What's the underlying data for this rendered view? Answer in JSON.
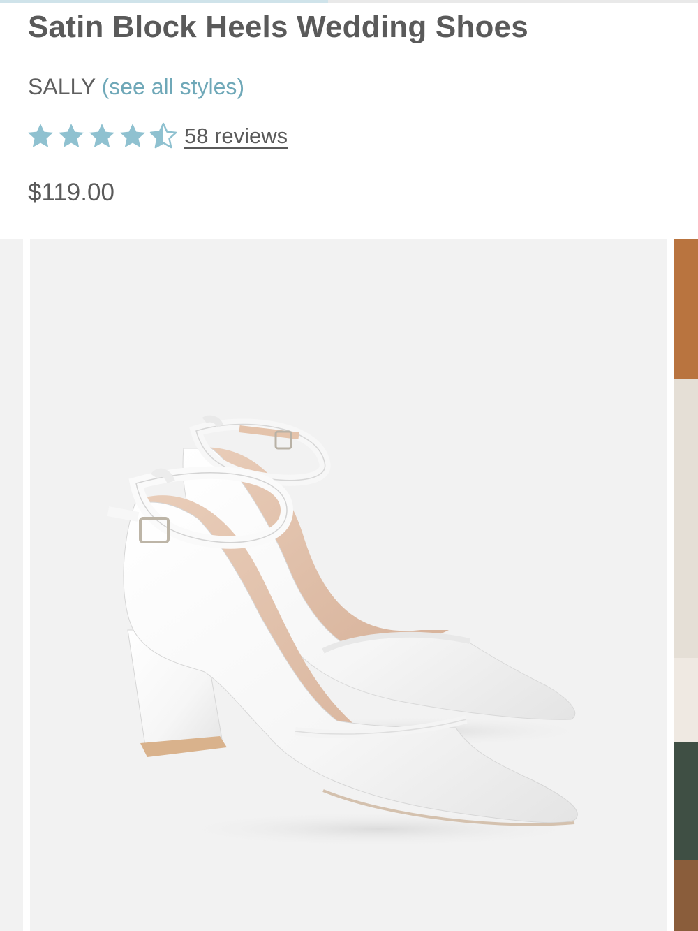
{
  "loading_progress": 0.47,
  "product": {
    "title": "Satin Block Heels Wedding Shoes",
    "brand": "SALLY",
    "see_all_label": "(see all styles)",
    "rating": 4.5,
    "rating_max": 5,
    "reviews_label": "58 reviews",
    "price": "$119.00"
  },
  "colors": {
    "accent": "#6fa8b8",
    "star": "#8fc1d0",
    "text": "#5a5a5a",
    "image_bg": "#f2f2f2"
  },
  "icons": {
    "star_full": "star-icon",
    "star_half": "star-half-icon"
  },
  "gallery": {
    "slides_visible": 3,
    "current_image": "white-satin-pointed-toe-block-heel-ankle-strap-pumps"
  }
}
